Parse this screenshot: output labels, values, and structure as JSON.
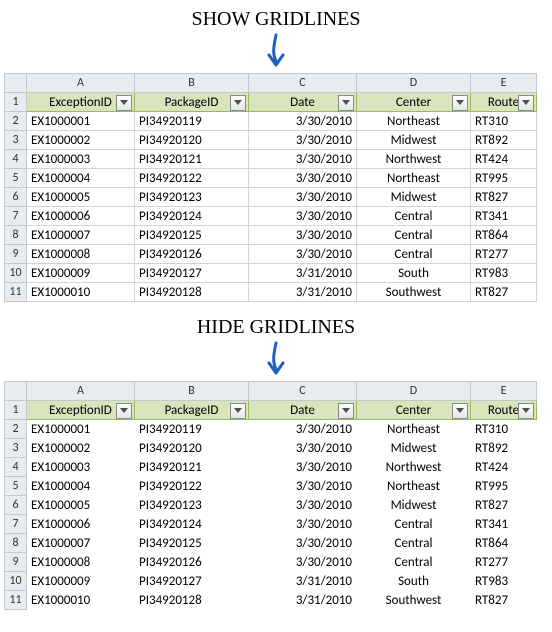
{
  "titles": {
    "show": "SHOW GRIDLINES",
    "hide": "HIDE GRIDLINES"
  },
  "columns": [
    "A",
    "B",
    "C",
    "D",
    "E"
  ],
  "rowNums": [
    "1",
    "2",
    "3",
    "4",
    "5",
    "6",
    "7",
    "8",
    "9",
    "10",
    "11"
  ],
  "headers": {
    "A": "ExceptionID",
    "B": "PackageID",
    "C": "Date",
    "D": "Center",
    "E": "Route"
  },
  "data": [
    {
      "A": "EX1000001",
      "B": "PI34920119",
      "C": "3/30/2010",
      "D": "Northeast",
      "E": "RT310"
    },
    {
      "A": "EX1000002",
      "B": "PI34920120",
      "C": "3/30/2010",
      "D": "Midwest",
      "E": "RT892"
    },
    {
      "A": "EX1000003",
      "B": "PI34920121",
      "C": "3/30/2010",
      "D": "Northwest",
      "E": "RT424"
    },
    {
      "A": "EX1000004",
      "B": "PI34920122",
      "C": "3/30/2010",
      "D": "Northeast",
      "E": "RT995"
    },
    {
      "A": "EX1000005",
      "B": "PI34920123",
      "C": "3/30/2010",
      "D": "Midwest",
      "E": "RT827"
    },
    {
      "A": "EX1000006",
      "B": "PI34920124",
      "C": "3/30/2010",
      "D": "Central",
      "E": "RT341"
    },
    {
      "A": "EX1000007",
      "B": "PI34920125",
      "C": "3/30/2010",
      "D": "Central",
      "E": "RT864"
    },
    {
      "A": "EX1000008",
      "B": "PI34920126",
      "C": "3/30/2010",
      "D": "Central",
      "E": "RT277"
    },
    {
      "A": "EX1000009",
      "B": "PI34920127",
      "C": "3/31/2010",
      "D": "South",
      "E": "RT983"
    },
    {
      "A": "EX1000010",
      "B": "PI34920128",
      "C": "3/31/2010",
      "D": "Southwest",
      "E": "RT827"
    }
  ],
  "colWidths": {
    "A": 108,
    "B": 114,
    "C": 108,
    "D": 114,
    "E": 66
  }
}
